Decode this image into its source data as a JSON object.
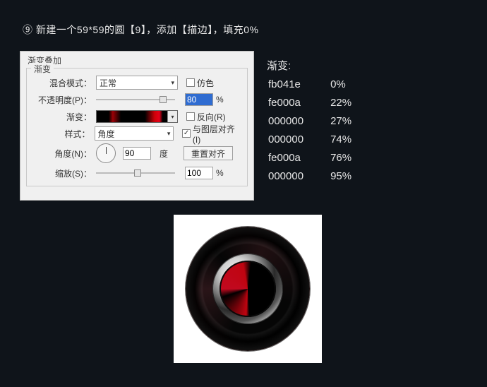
{
  "step_title": "⑨ 新建一个59*59的圆【9】，添加【描边】，填充0%",
  "dialog": {
    "title": "渐变叠加",
    "group_label": "渐变",
    "blend_label": "混合模式：",
    "blend_value": "正常",
    "dither_label": "仿色",
    "opacity_label": "不透明度(P)：",
    "opacity_value": "80",
    "percent": "%",
    "gradient_label": "渐变：",
    "reverse_label": "反向(R)",
    "style_label": "样式：",
    "style_value": "角度",
    "align_label": "与图层对齐(I)",
    "angle_label": "角度(N)：",
    "angle_value": "90",
    "angle_unit": "度",
    "reset_align": "重置对齐",
    "scale_label": "缩放(S)：",
    "scale_value": "100"
  },
  "grad_info": {
    "heading": "渐变:",
    "rows": [
      {
        "hex": "fb041e",
        "pos": "0%"
      },
      {
        "hex": "fe000a",
        "pos": "22%"
      },
      {
        "hex": "000000",
        "pos": "27%"
      },
      {
        "hex": "000000",
        "pos": "74%"
      },
      {
        "hex": "fe000a",
        "pos": "76%"
      },
      {
        "hex": "000000",
        "pos": "95%"
      }
    ]
  }
}
